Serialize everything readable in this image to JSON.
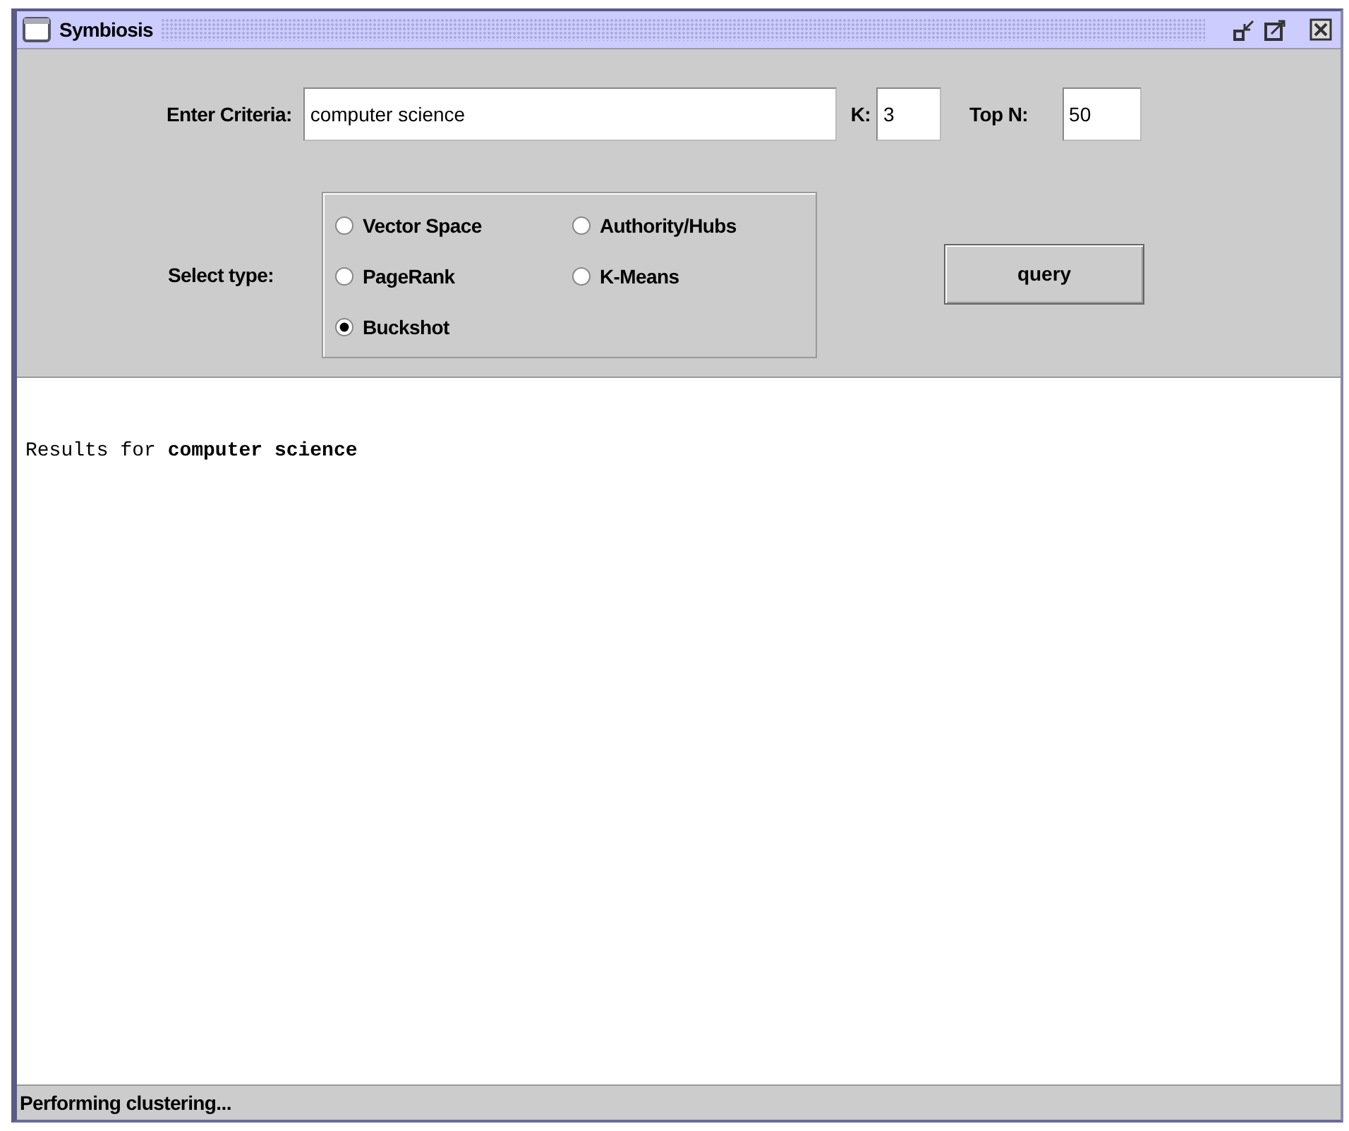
{
  "window": {
    "title": "Symbiosis"
  },
  "criteria": {
    "label": "Enter Criteria:",
    "value": "computer science"
  },
  "k": {
    "label": "K:",
    "value": "3"
  },
  "top_n": {
    "label": "Top N:",
    "value": "50"
  },
  "select_type": {
    "label": "Select type:",
    "options": [
      {
        "label": "Vector Space",
        "selected": false
      },
      {
        "label": "Authority/Hubs",
        "selected": false
      },
      {
        "label": "PageRank",
        "selected": false
      },
      {
        "label": "K-Means",
        "selected": false
      },
      {
        "label": "Buckshot",
        "selected": true
      }
    ]
  },
  "query_button": "query",
  "results": "Results for **computer science**",
  "status_bar": "Performing clustering..."
}
